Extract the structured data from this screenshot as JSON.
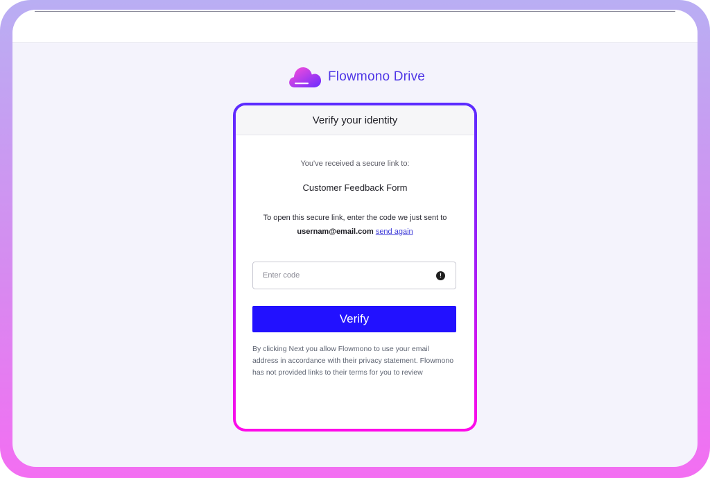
{
  "brand": {
    "name": "Flowmono Drive",
    "logo_icon": "cloud-logo-icon",
    "colors": {
      "name": "#4e36e6",
      "logo_gradient_start": "#ff4fd8",
      "logo_gradient_end": "#6a2cff"
    }
  },
  "card": {
    "header_title": "Verify your identity",
    "intro_text": "You've received a secure link to:",
    "document_title": "Customer Feedback Form",
    "instructions": "To open this secure link, enter the code we just sent to",
    "email": "usernam@email.com",
    "send_again_label": "send again",
    "code_input": {
      "placeholder": "Enter code",
      "value": "",
      "status_icon": "alert-circle-icon"
    },
    "verify_label": "Verify",
    "disclaimer": "By clicking Next you allow Flowmono to use your email address in accordance with their privacy statement. Flowmono has not provided links to their terms for you to review"
  },
  "colors": {
    "primary_button": "#2211ff",
    "border_gradient_top": "#5b2bff",
    "border_gradient_bottom": "#ff0be9",
    "page_background": "#f4f3fc",
    "link": "#3d3ad8"
  }
}
